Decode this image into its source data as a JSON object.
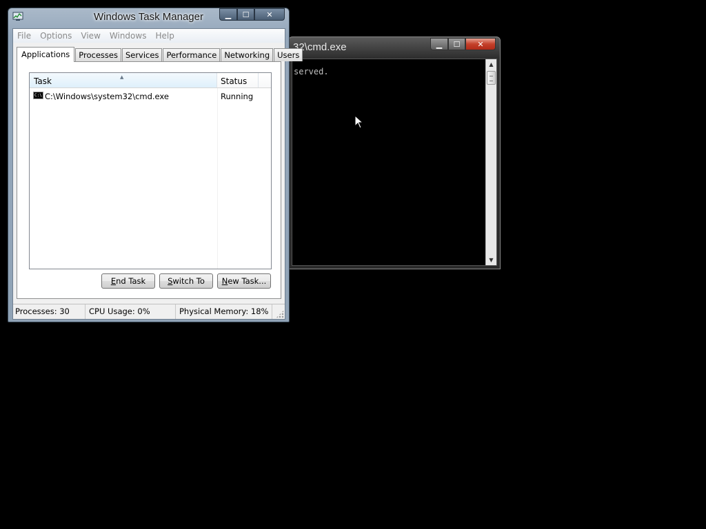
{
  "cmd_window": {
    "title": "32\\cmd.exe",
    "text": "served."
  },
  "task_manager": {
    "title": "Windows Task Manager",
    "menu": [
      "File",
      "Options",
      "View",
      "Windows",
      "Help"
    ],
    "tabs": [
      "Applications",
      "Processes",
      "Services",
      "Performance",
      "Networking",
      "Users"
    ],
    "active_tab": "Applications",
    "columns": {
      "task": "Task",
      "status": "Status"
    },
    "rows": [
      {
        "icon_text": "C:\\",
        "task": "C:\\Windows\\system32\\cmd.exe",
        "status": "Running"
      }
    ],
    "buttons": {
      "end_task": {
        "underline": "E",
        "rest": "nd Task"
      },
      "switch_to": {
        "underline": "S",
        "rest": "witch To"
      },
      "new_task": {
        "underline": "N",
        "rest": "ew Task..."
      }
    },
    "statusbar": {
      "processes": "Processes: 30",
      "cpu": "CPU Usage: 0%",
      "memory": "Physical Memory: 18%"
    }
  },
  "window_controls": {
    "minimize": "▁",
    "maximize": "☐",
    "close": "✕"
  }
}
